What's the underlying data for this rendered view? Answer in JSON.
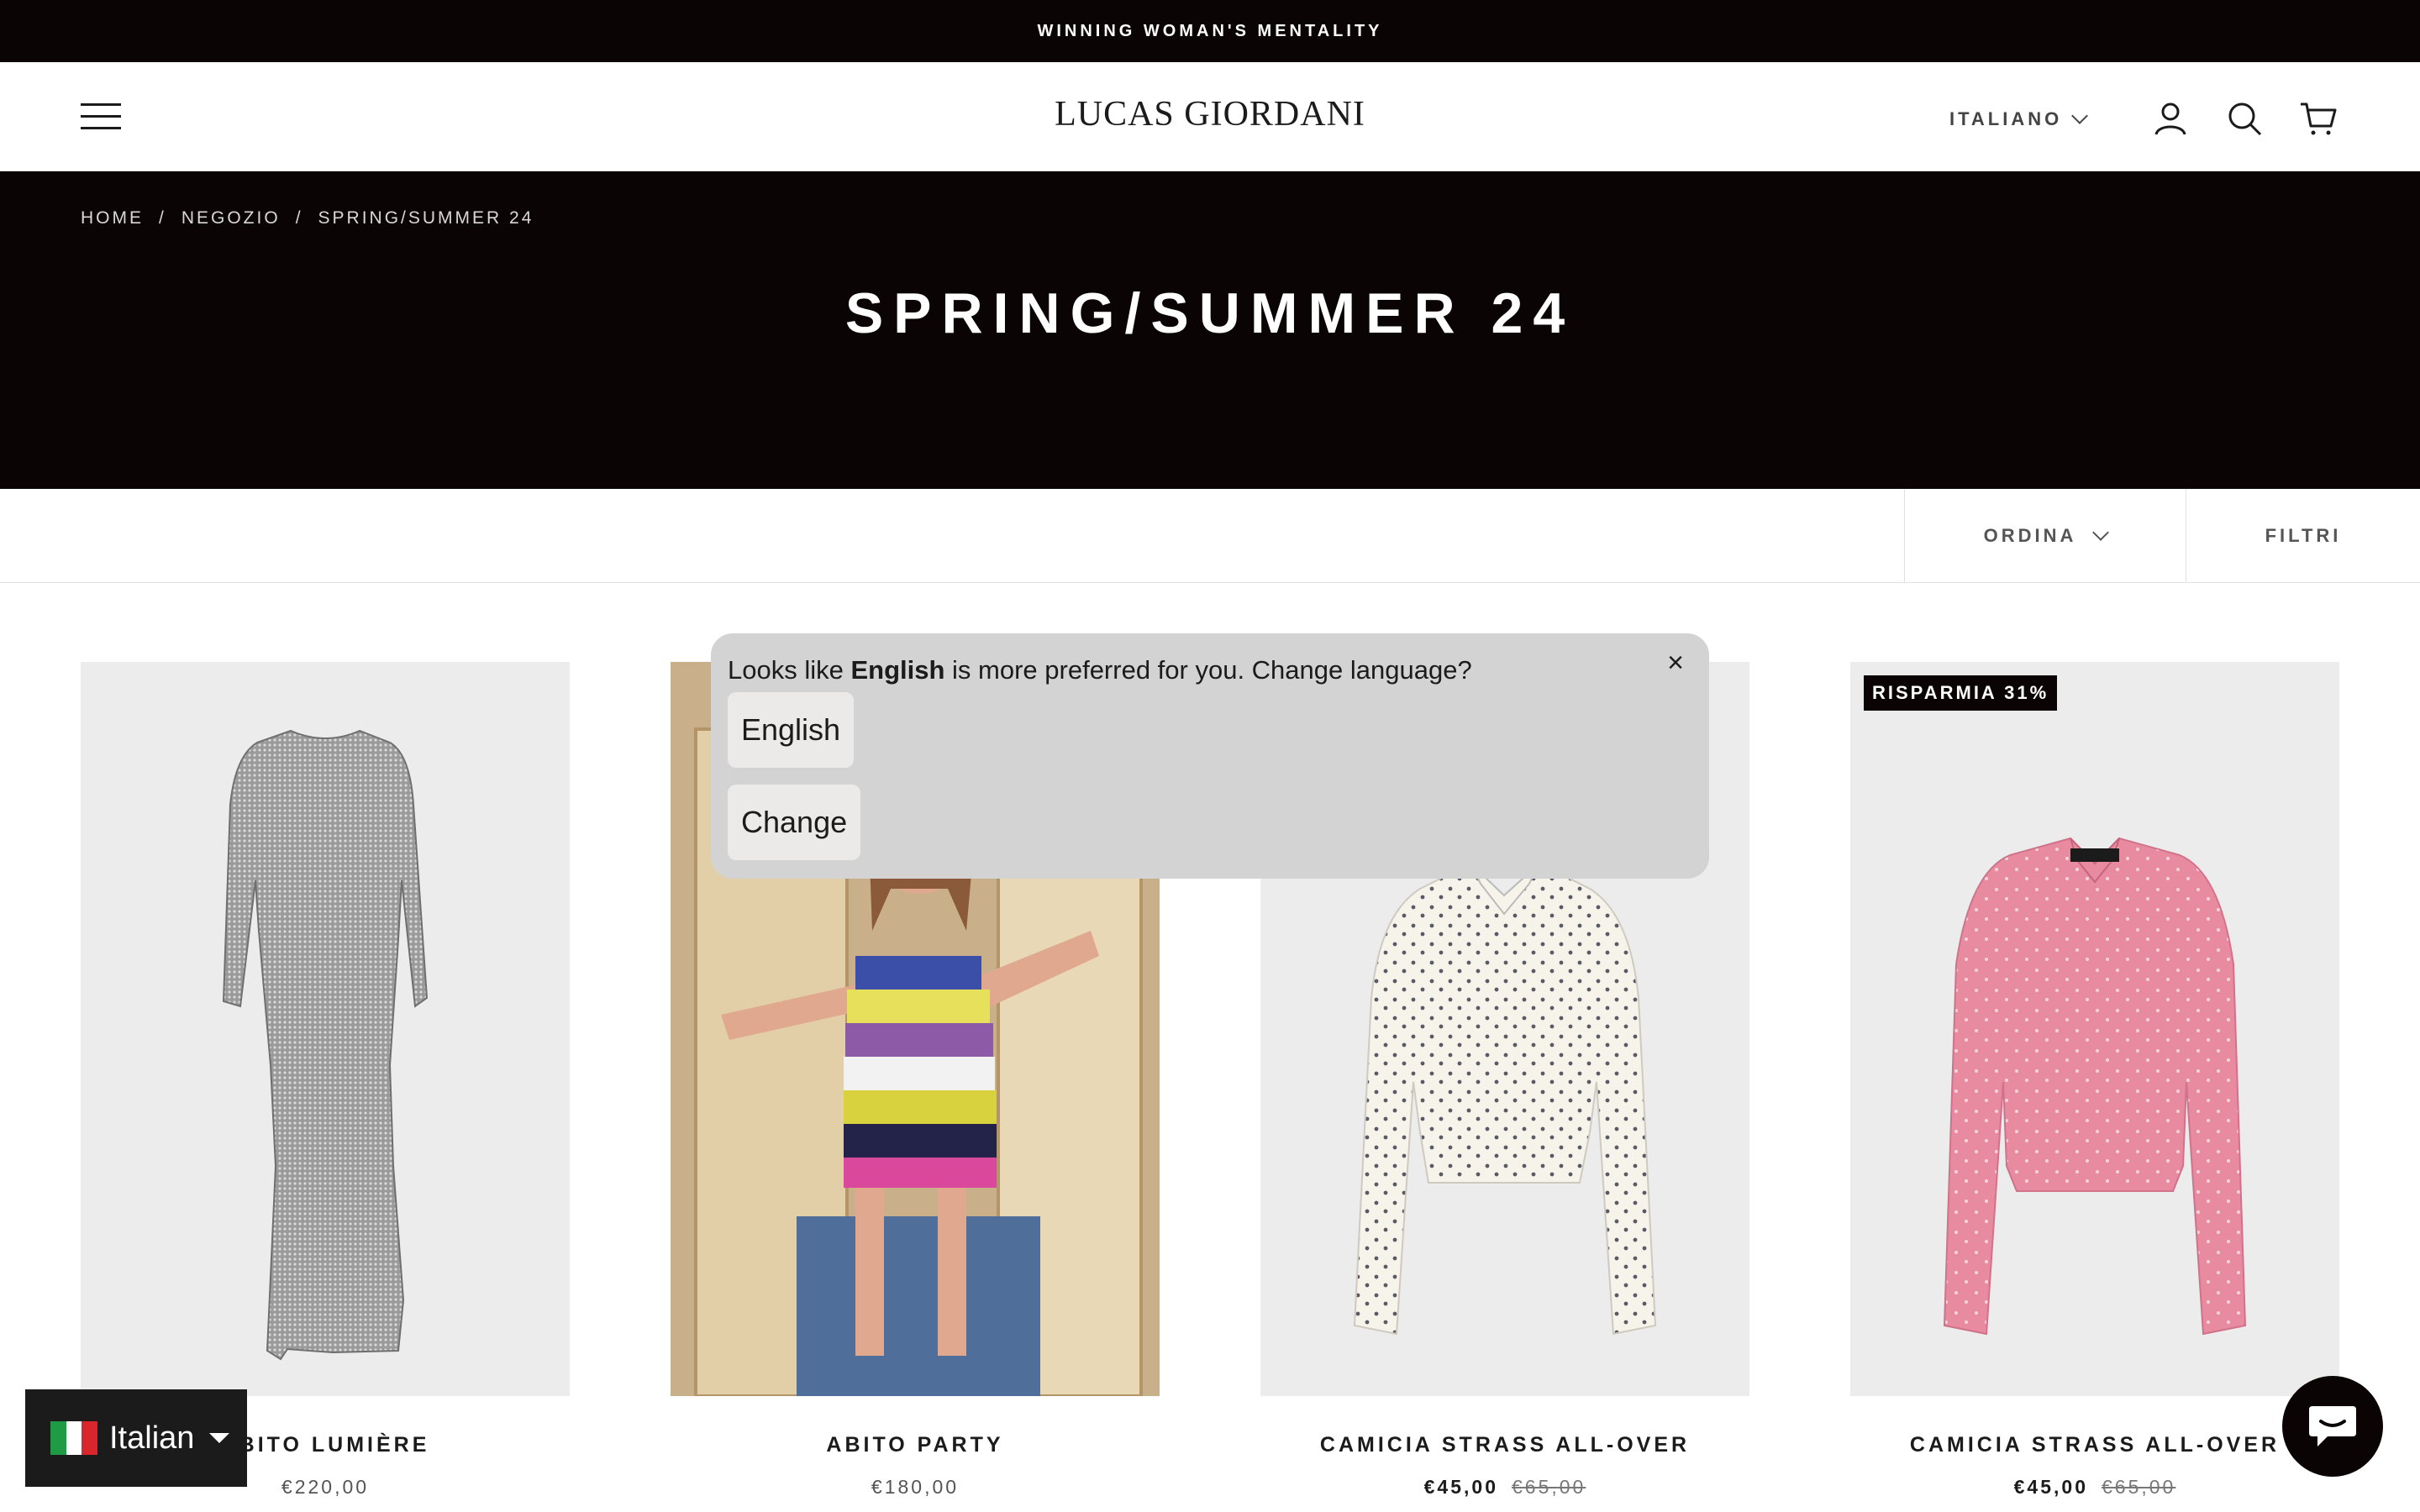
{
  "announcement": {
    "text": "WINNING WOMAN'S MENTALITY"
  },
  "header": {
    "logo": "LUCAS GIORDANI",
    "language_label": "ITALIANO",
    "icons": [
      "menu-icon",
      "account-icon",
      "search-icon",
      "cart-icon"
    ]
  },
  "hero": {
    "breadcrumb": [
      "HOME",
      "/",
      "NEGOZIO",
      "/",
      "SPRING/SUMMER 24"
    ],
    "title": "SPRING/SUMMER 24"
  },
  "toolbar": {
    "sort_label": "ORDINA",
    "filter_label": "FILTRI"
  },
  "products": [
    {
      "name": "ABITO LUMIÈRE",
      "price": "€220,00",
      "compare_price": "",
      "badge": ""
    },
    {
      "name": "ABITO PARTY",
      "price": "€180,00",
      "compare_price": "",
      "badge": ""
    },
    {
      "name": "CAMICIA STRASS ALL-OVER",
      "price": "€45,00",
      "compare_price": "€65,00",
      "badge": ""
    },
    {
      "name": "CAMICIA STRASS ALL-OVER",
      "price": "€45,00",
      "compare_price": "€65,00",
      "badge": "RISPARMIA 31%"
    }
  ],
  "language_popup": {
    "message_prefix": "Looks like ",
    "message_language": "English",
    "message_suffix": " is more preferred for you. Change language?",
    "option_button": "English",
    "change_button": "Change",
    "close": "×"
  },
  "language_widget": {
    "label": "Italian"
  },
  "colors": {
    "dark": "#0b0405",
    "popup": "#d3d3d3",
    "text": "#1c1b1b",
    "pink_shirt": "#e98ba0"
  }
}
